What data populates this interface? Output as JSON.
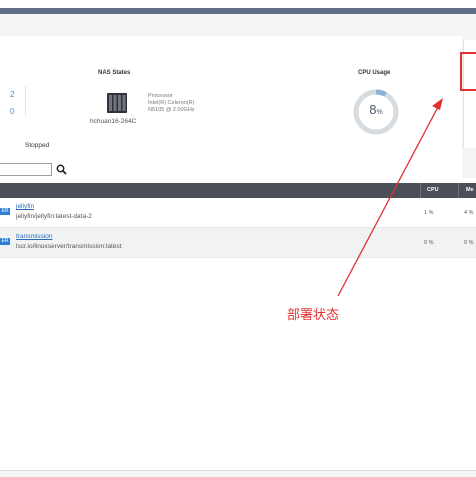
{
  "stats": {
    "value_top": "2",
    "value_bottom": "0"
  },
  "nas": {
    "title": "NAS States",
    "processor_label": "Processor",
    "processor_line1": "Intel(R) Celeron(R)",
    "processor_line2": "N5105 @ 2.00GHz",
    "hostname": "hchuan16-264C",
    "icon": "nas-device-icon"
  },
  "cpu": {
    "title": "CPU Usage",
    "value": "8",
    "unit": "%",
    "level": 0.08,
    "accent": "#8ab3d6"
  },
  "status": {
    "stopped_label": "Stopped"
  },
  "search": {
    "placeholder": "",
    "value": ""
  },
  "table": {
    "header": {
      "cpu": "CPU",
      "mem": "Me"
    },
    "rows": [
      {
        "badge": "ER",
        "name": "jellyfin",
        "image": "jellyfin/jellyfin:latest-data-2",
        "cpu": "1 %",
        "mem": "4 %"
      },
      {
        "badge": "ER",
        "name": "transmission",
        "image": "lscr.io/linuxserver/transmission:latest",
        "cpu": "0 %",
        "mem": "0 %"
      }
    ]
  },
  "annotation": {
    "text": "部署状态",
    "color": "#e03131"
  }
}
